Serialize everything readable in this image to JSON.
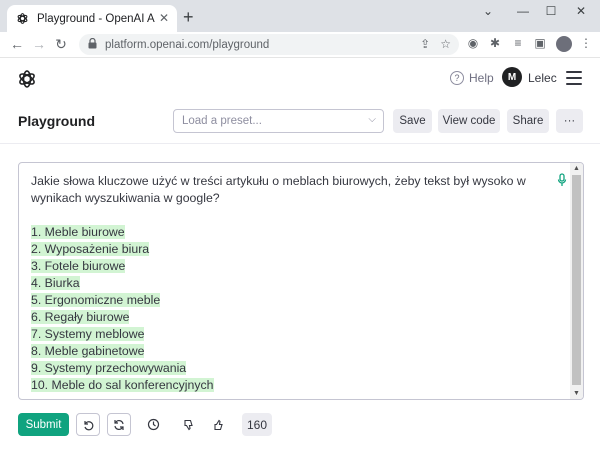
{
  "browser": {
    "tab_title": "Playground - OpenAI API",
    "url": "platform.openai.com/playground"
  },
  "header": {
    "help_label": "Help",
    "help_icon_glyph": "?",
    "avatar_initial": "M",
    "user_name": "Lelec"
  },
  "toolbar": {
    "title": "Playground",
    "preset_placeholder": "Load a preset...",
    "save_label": "Save",
    "view_code_label": "View code",
    "share_label": "Share",
    "more_label": "···"
  },
  "editor": {
    "prompt_lines": [
      "Jakie słowa kluczowe użyć w treści artykułu o meblach biurowych, żeby tekst był wysoko w",
      "wynikach wyszukiwania w google?"
    ],
    "completion_lines": [
      "1. Meble biurowe",
      "2. Wyposażenie biura",
      "3. Fotele biurowe",
      "4. Biurka",
      "5. Ergonomiczne meble",
      "6. Regały biurowe",
      "7. Systemy meblowe",
      "8. Meble gabinetowe",
      "9. Systemy przechowywania",
      "10. Meble do sal konferencyjnych"
    ],
    "completion_highlight_color": "#d2f4d3"
  },
  "footer": {
    "submit_label": "Submit",
    "token_count": "160"
  },
  "colors": {
    "submit": "#10a37f",
    "button_bg": "#ececf1"
  }
}
